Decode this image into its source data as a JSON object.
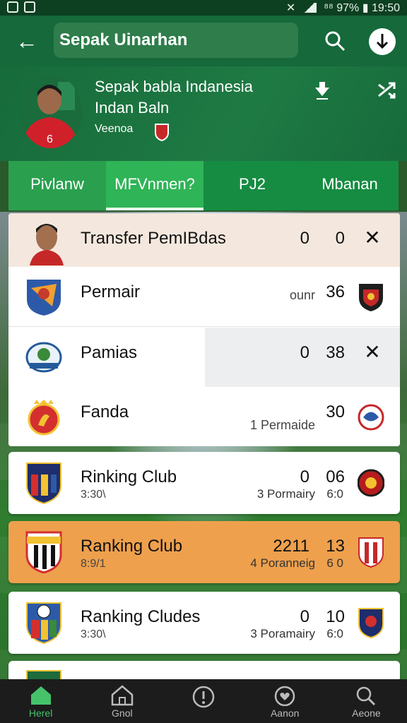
{
  "status_bar": {
    "right_text": "⁸⁸ 97% ▮ 19:50"
  },
  "app_bar": {
    "title": "Sepak Uinarhan"
  },
  "header": {
    "team_name": "Sepak babla Indanesia",
    "team_sub": "Indan Baln",
    "team_tag": "Veenoa"
  },
  "tabs": [
    {
      "label": "Pivlanw"
    },
    {
      "label": "MFVnmen?"
    },
    {
      "label": "PJ2"
    },
    {
      "label": "Mbanan"
    }
  ],
  "transfer_row": {
    "label": "Transfer PemIBdas",
    "v1": "0",
    "v2": "0"
  },
  "list_rows": [
    {
      "label": "Permair",
      "note": "ounr",
      "v2": "36"
    },
    {
      "label": "Pamias",
      "v1": "0",
      "v2": "38"
    },
    {
      "label": "Fanda",
      "note": "1 Permaide",
      "v2": "30"
    }
  ],
  "ranking_cards": [
    {
      "label": "Rinking Club",
      "sub": "3:30\\",
      "v1": "0",
      "v2": "06",
      "note": "3 Pormairy",
      "note2": "6:0"
    },
    {
      "label": "Ranking Club",
      "sub": "8:9/1",
      "v1": "2211",
      "v2": "13",
      "note": "4 Poranneig",
      "note2": "6 0"
    },
    {
      "label": "Ranking Cludes",
      "sub": "3:30\\",
      "v1": "0",
      "v2": "10",
      "note": "3 Poramairy",
      "note2": "6:0"
    }
  ],
  "bottom_nav": [
    {
      "label": "Herel",
      "icon": "home-icon"
    },
    {
      "label": "Gnol",
      "icon": "home-outline-icon"
    },
    {
      "label": "",
      "icon": "info-icon"
    },
    {
      "label": "Aanon",
      "icon": "heart-icon"
    },
    {
      "label": "Aeone",
      "icon": "search-icon"
    }
  ],
  "colors": {
    "primary": "#15693a",
    "tab": "#2aa04f",
    "highlight": "#eea04d",
    "nav_active": "#46c26a"
  }
}
